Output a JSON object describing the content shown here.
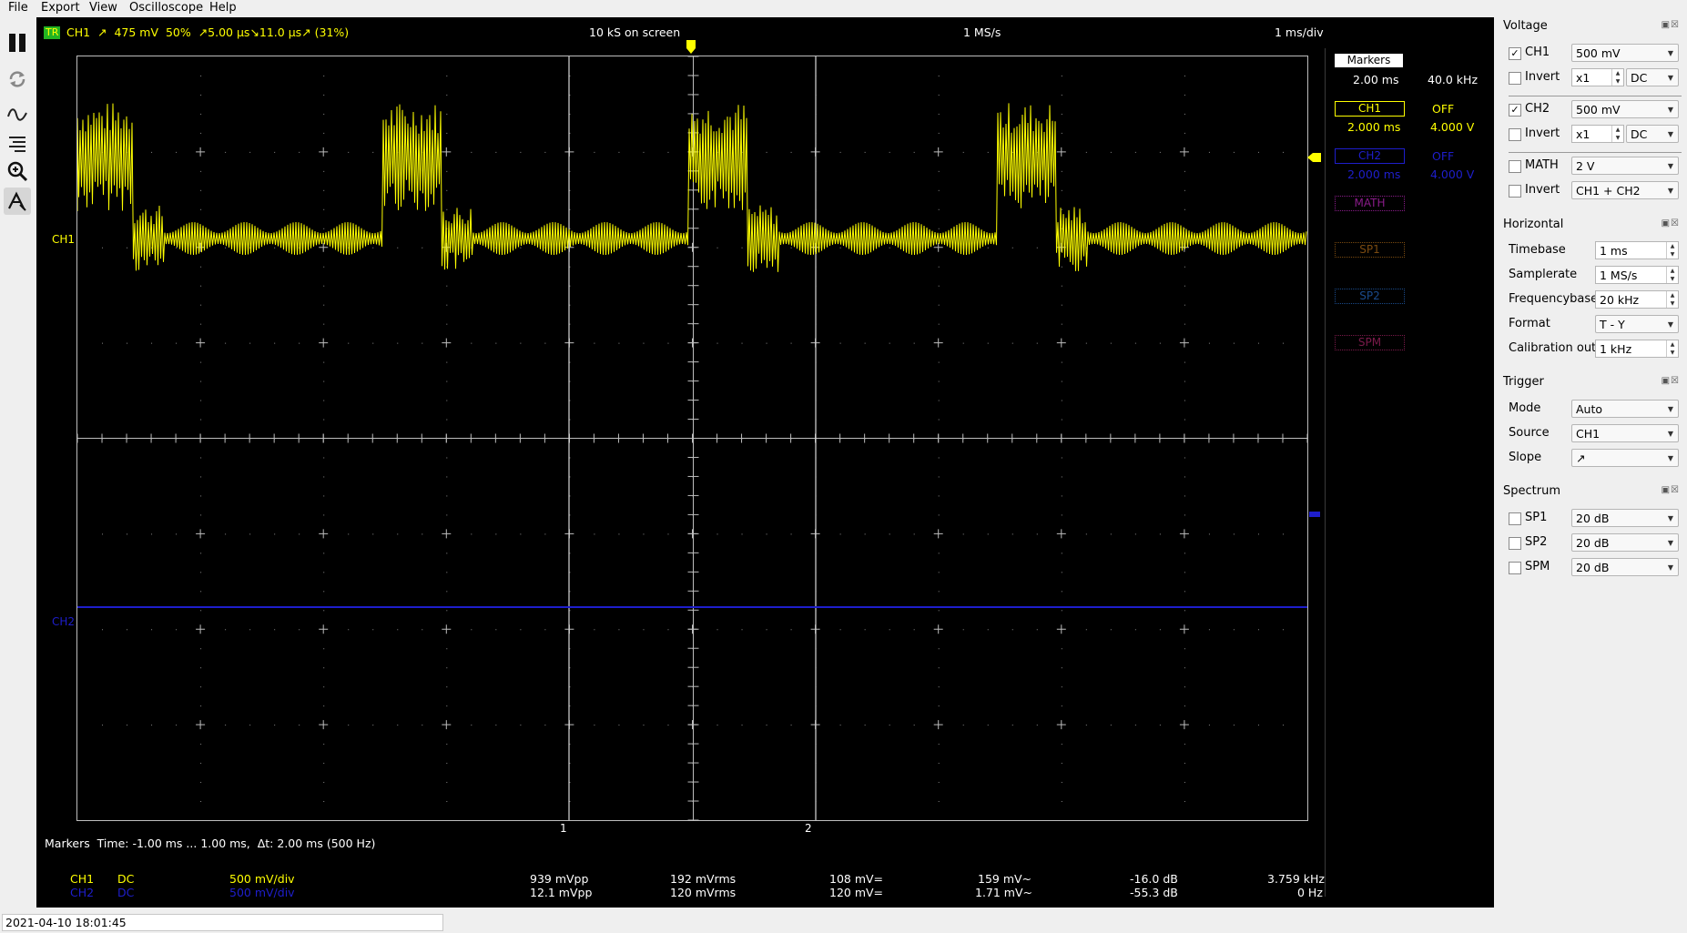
{
  "menubar": {
    "items": [
      "File",
      "Export",
      "View",
      "Oscilloscope",
      "Help"
    ]
  },
  "toolbar": {
    "buttons": [
      "pause-icon",
      "refresh-icon",
      "waveform-icon",
      "align-icon",
      "zoom-icon",
      "measure-icon"
    ]
  },
  "topbar": {
    "trigger_badge": "TR",
    "trigger_info": "CH1  ↗  475 mV  50%  ↗5.00 µs↘11.0 µs↗ (31%)",
    "samples_on_screen": "10 kS on screen",
    "samplerate": "1 MS/s",
    "timebase": "1 ms/div"
  },
  "scope": {
    "ch1_label": "CH1",
    "ch2_label": "CH2",
    "marker1_label": "1",
    "marker2_label": "2",
    "colors": {
      "ch1": "#ffff00",
      "ch2": "#1e1ecc",
      "grid": "#bdbdbd",
      "background": "#000000"
    }
  },
  "markers_panel": {
    "title": "Markers",
    "dt": "2.00 ms",
    "freq": "40.0 kHz",
    "ch1": {
      "label": "CH1",
      "state": "OFF",
      "time": "2.000 ms",
      "value": "4.000 V"
    },
    "ch2": {
      "label": "CH2",
      "state": "OFF",
      "time": "2.000 ms",
      "value": "4.000 V"
    },
    "math": "MATH",
    "sp1": "SP1",
    "sp2": "SP2",
    "spm": "SPM"
  },
  "markers_info": "Markers  Time: -1.00 ms ... 1.00 ms,  Δt: 2.00 ms (500 Hz)",
  "measurements": {
    "ch1": {
      "name": "CH1",
      "coupling": "DC",
      "scale": "500 mV/div",
      "vpp": "939 mVpp",
      "vrms": "192 mVrms",
      "vdc": "108 mV=",
      "vac": "159 mV~",
      "db": "-16.0 dB",
      "freq": "3.759 kHz"
    },
    "ch2": {
      "name": "CH2",
      "coupling": "DC",
      "scale": "500 mV/div",
      "vpp": "12.1 mVpp",
      "vrms": "120 mVrms",
      "vdc": "120 mV=",
      "vac": "1.71 mV~",
      "db": "-55.3 dB",
      "freq": "0 Hz"
    }
  },
  "voltage": {
    "title": "Voltage",
    "ch1": {
      "label": "CH1",
      "checked": true,
      "gain": "500 mV",
      "invert_label": "Invert",
      "probe": "x1",
      "coupling": "DC"
    },
    "ch2": {
      "label": "CH2",
      "checked": true,
      "gain": "500 mV",
      "invert_label": "Invert",
      "probe": "x1",
      "coupling": "DC"
    },
    "math": {
      "label": "MATH",
      "checked": false,
      "gain": "2 V",
      "invert_label": "Invert",
      "mode": "CH1 + CH2"
    }
  },
  "horizontal": {
    "title": "Horizontal",
    "timebase_label": "Timebase",
    "timebase": "1 ms",
    "samplerate_label": "Samplerate",
    "samplerate": "1 MS/s",
    "freqbase_label": "Frequencybase",
    "freqbase": "20 kHz",
    "format_label": "Format",
    "format": "T - Y",
    "calibration_label": "Calibration out",
    "calibration": "1 kHz"
  },
  "trigger": {
    "title": "Trigger",
    "mode_label": "Mode",
    "mode": "Auto",
    "source_label": "Source",
    "source": "CH1",
    "slope_label": "Slope",
    "slope": "↗"
  },
  "spectrum": {
    "title": "Spectrum",
    "sp1": {
      "label": "SP1",
      "value": "20 dB"
    },
    "sp2": {
      "label": "SP2",
      "value": "20 dB"
    },
    "spm": {
      "label": "SPM",
      "value": "20 dB"
    }
  },
  "status": {
    "timestamp": "2021-04-10 18:01:45"
  }
}
